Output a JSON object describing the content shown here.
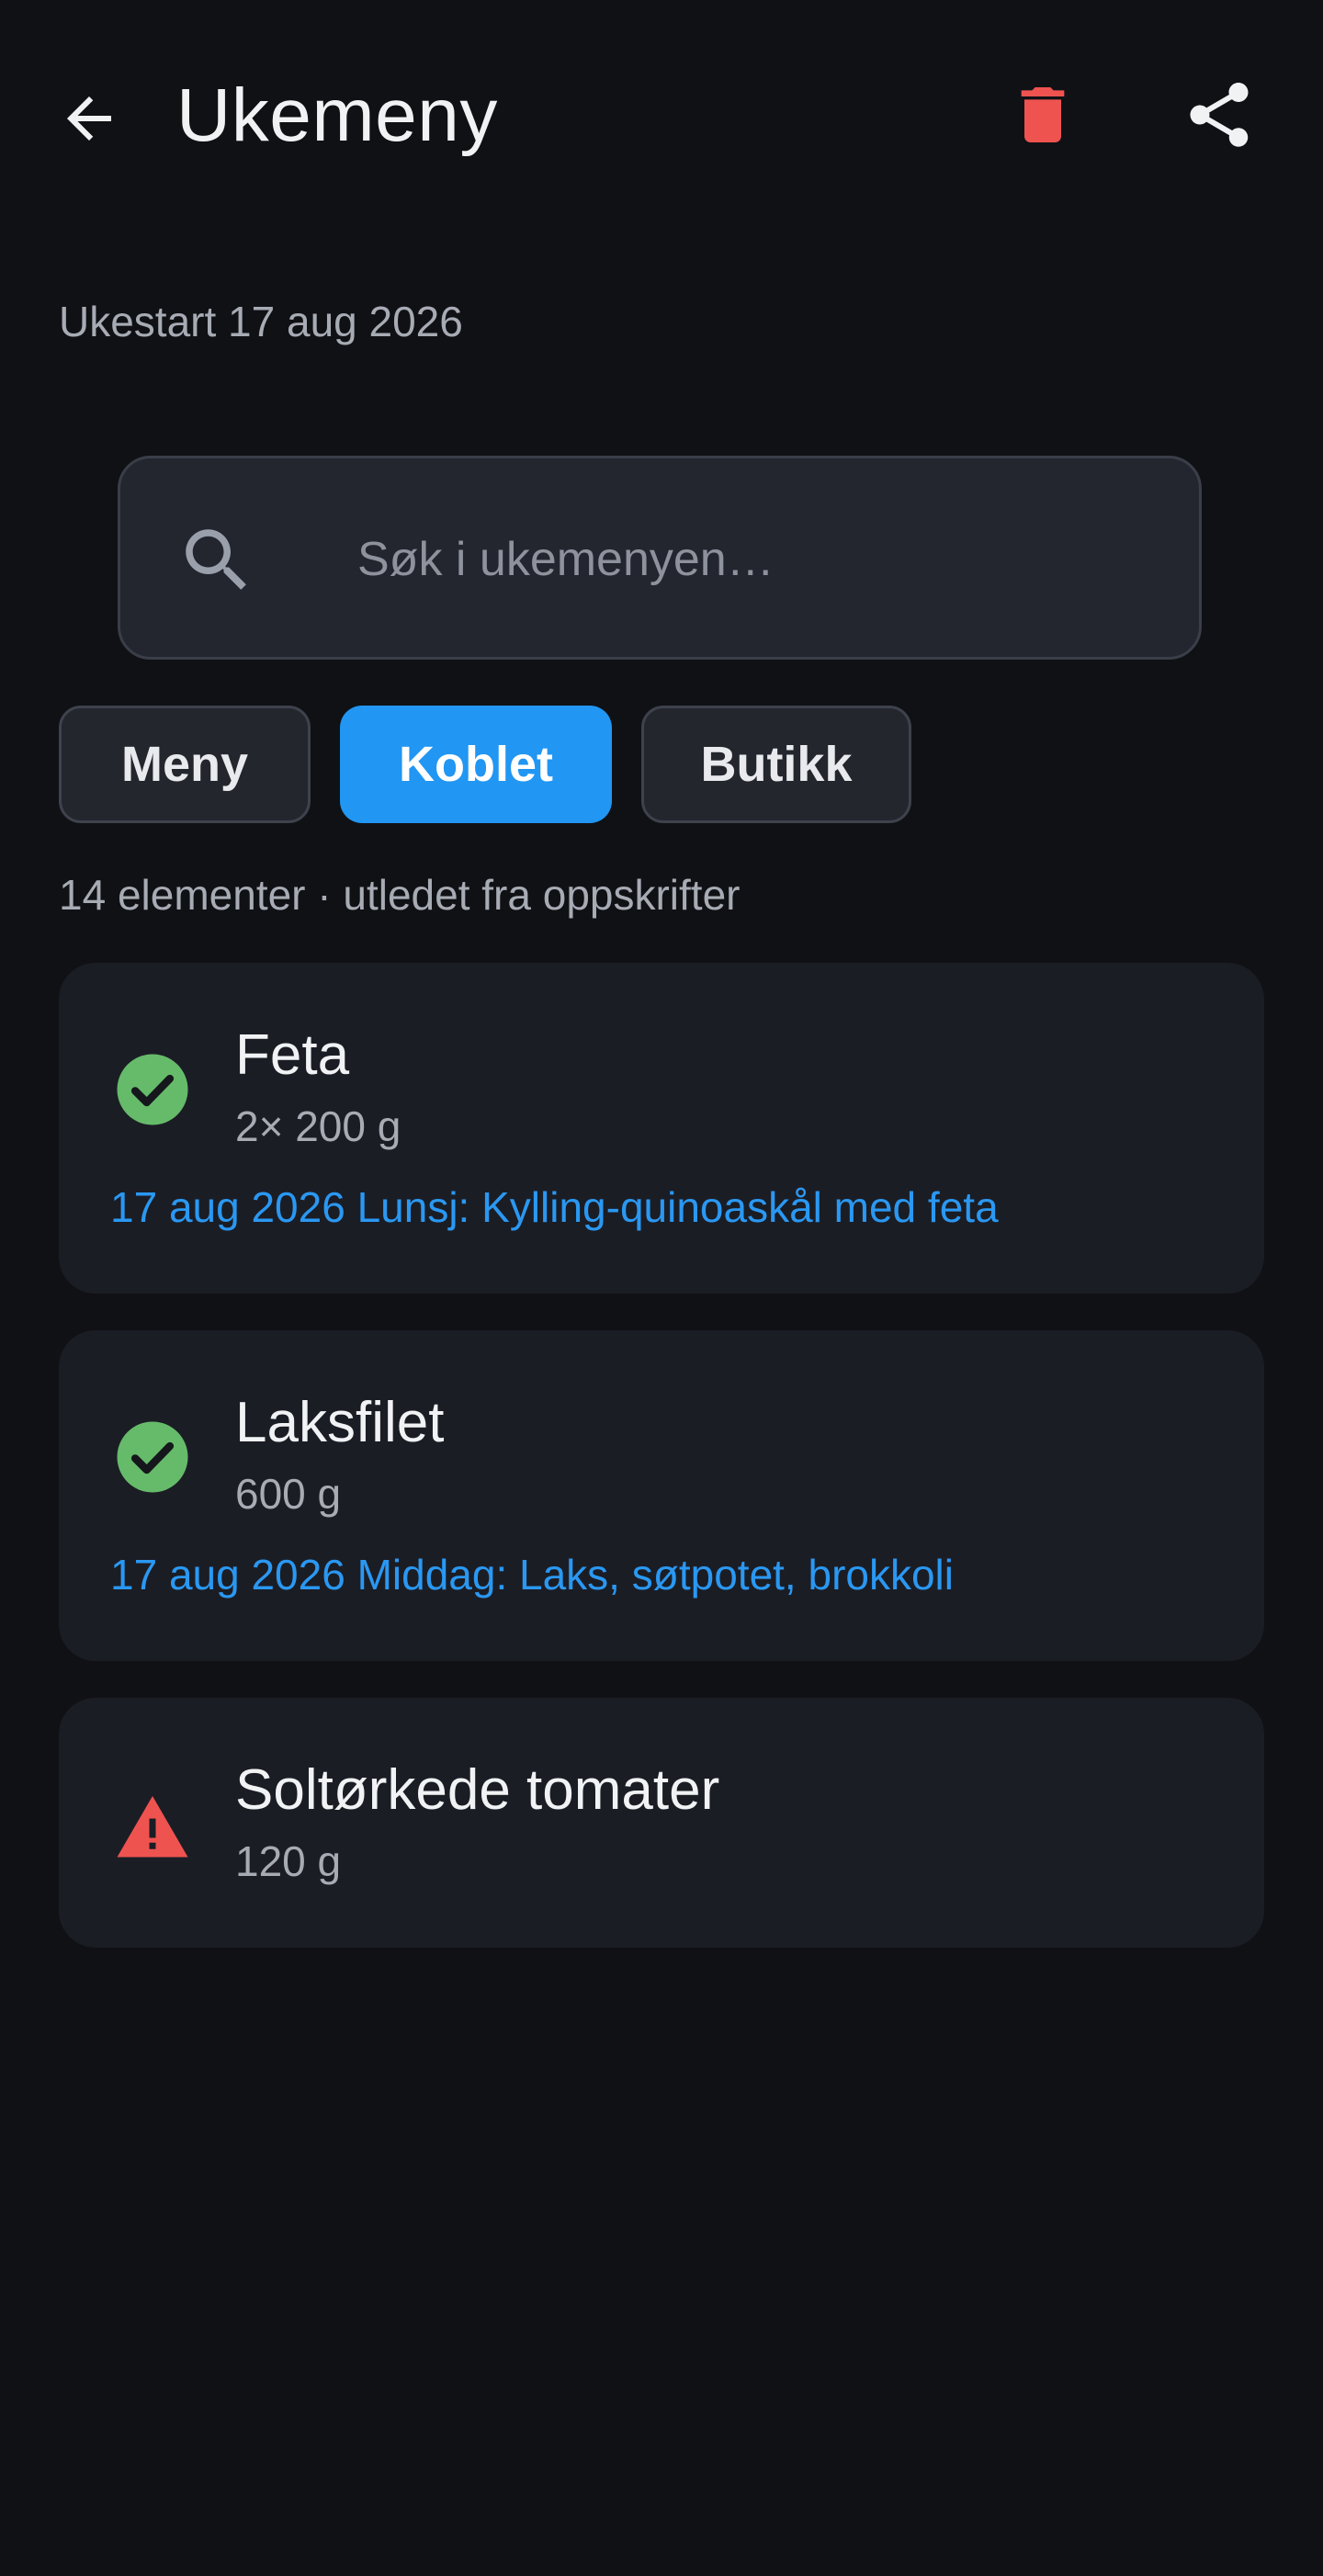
{
  "header": {
    "title": "Ukemeny",
    "colors": {
      "delete": "#ef5350",
      "icon": "#f1f2f4"
    }
  },
  "week_start": "Ukestart 17 aug 2026",
  "search": {
    "placeholder": "Søk i ukemenyen…",
    "value": ""
  },
  "tabs": [
    {
      "label": "Meny",
      "active": false
    },
    {
      "label": "Koblet",
      "active": true
    },
    {
      "label": "Butikk",
      "active": false
    }
  ],
  "summary": "14 elementer · utledet fra oppskrifter",
  "items": [
    {
      "name": "Feta",
      "quantity": "2× 200 g",
      "status": "check-circle-icon",
      "link": "17 aug 2026 Lunsj: Kylling-quinoaskål med feta"
    },
    {
      "name": "Laksfilet",
      "quantity": "600 g",
      "status": "check-circle-icon",
      "link": "17 aug 2026 Middag: Laks, søtpotet, brokkoli"
    },
    {
      "name": "Soltørkede tomater",
      "quantity": "120 g",
      "status": "warning-icon"
    }
  ],
  "colors": {
    "background": "#101115",
    "card": "#1b1d25",
    "accent": "#2196f3",
    "link": "#2a98f2",
    "success": "#66bb6a",
    "warning": "#ef5350",
    "muted_text": "#a7abb4"
  }
}
